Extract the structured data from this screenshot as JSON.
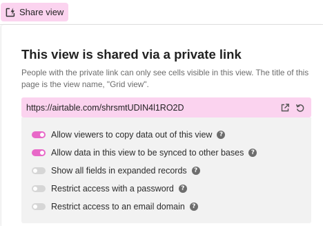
{
  "toolbar": {
    "share_label": "Share view"
  },
  "dialog": {
    "title": "This view is shared via a private link",
    "description": "People with the private link can only see cells visible in this view. The title of this page is the view name, \"Grid view\".",
    "link": "https://airtable.com/shrsmtUDIN4l1RO2D",
    "help_glyph": "?"
  },
  "options": [
    {
      "label": "Allow viewers to copy data out of this view",
      "enabled": true
    },
    {
      "label": "Allow data in this view to be synced to other bases",
      "enabled": true
    },
    {
      "label": "Show all fields in expanded records",
      "enabled": false
    },
    {
      "label": "Restrict access with a password",
      "enabled": false
    },
    {
      "label": "Restrict access to an email domain",
      "enabled": false
    }
  ],
  "colors": {
    "accent": "#fbd3ef",
    "toggle_on": "#e868c8",
    "toggle_off": "#d6d6d6"
  },
  "icons": {
    "share": "share-lightning-icon",
    "open": "open-external-icon",
    "regenerate": "regenerate-icon",
    "help": "help-icon"
  }
}
